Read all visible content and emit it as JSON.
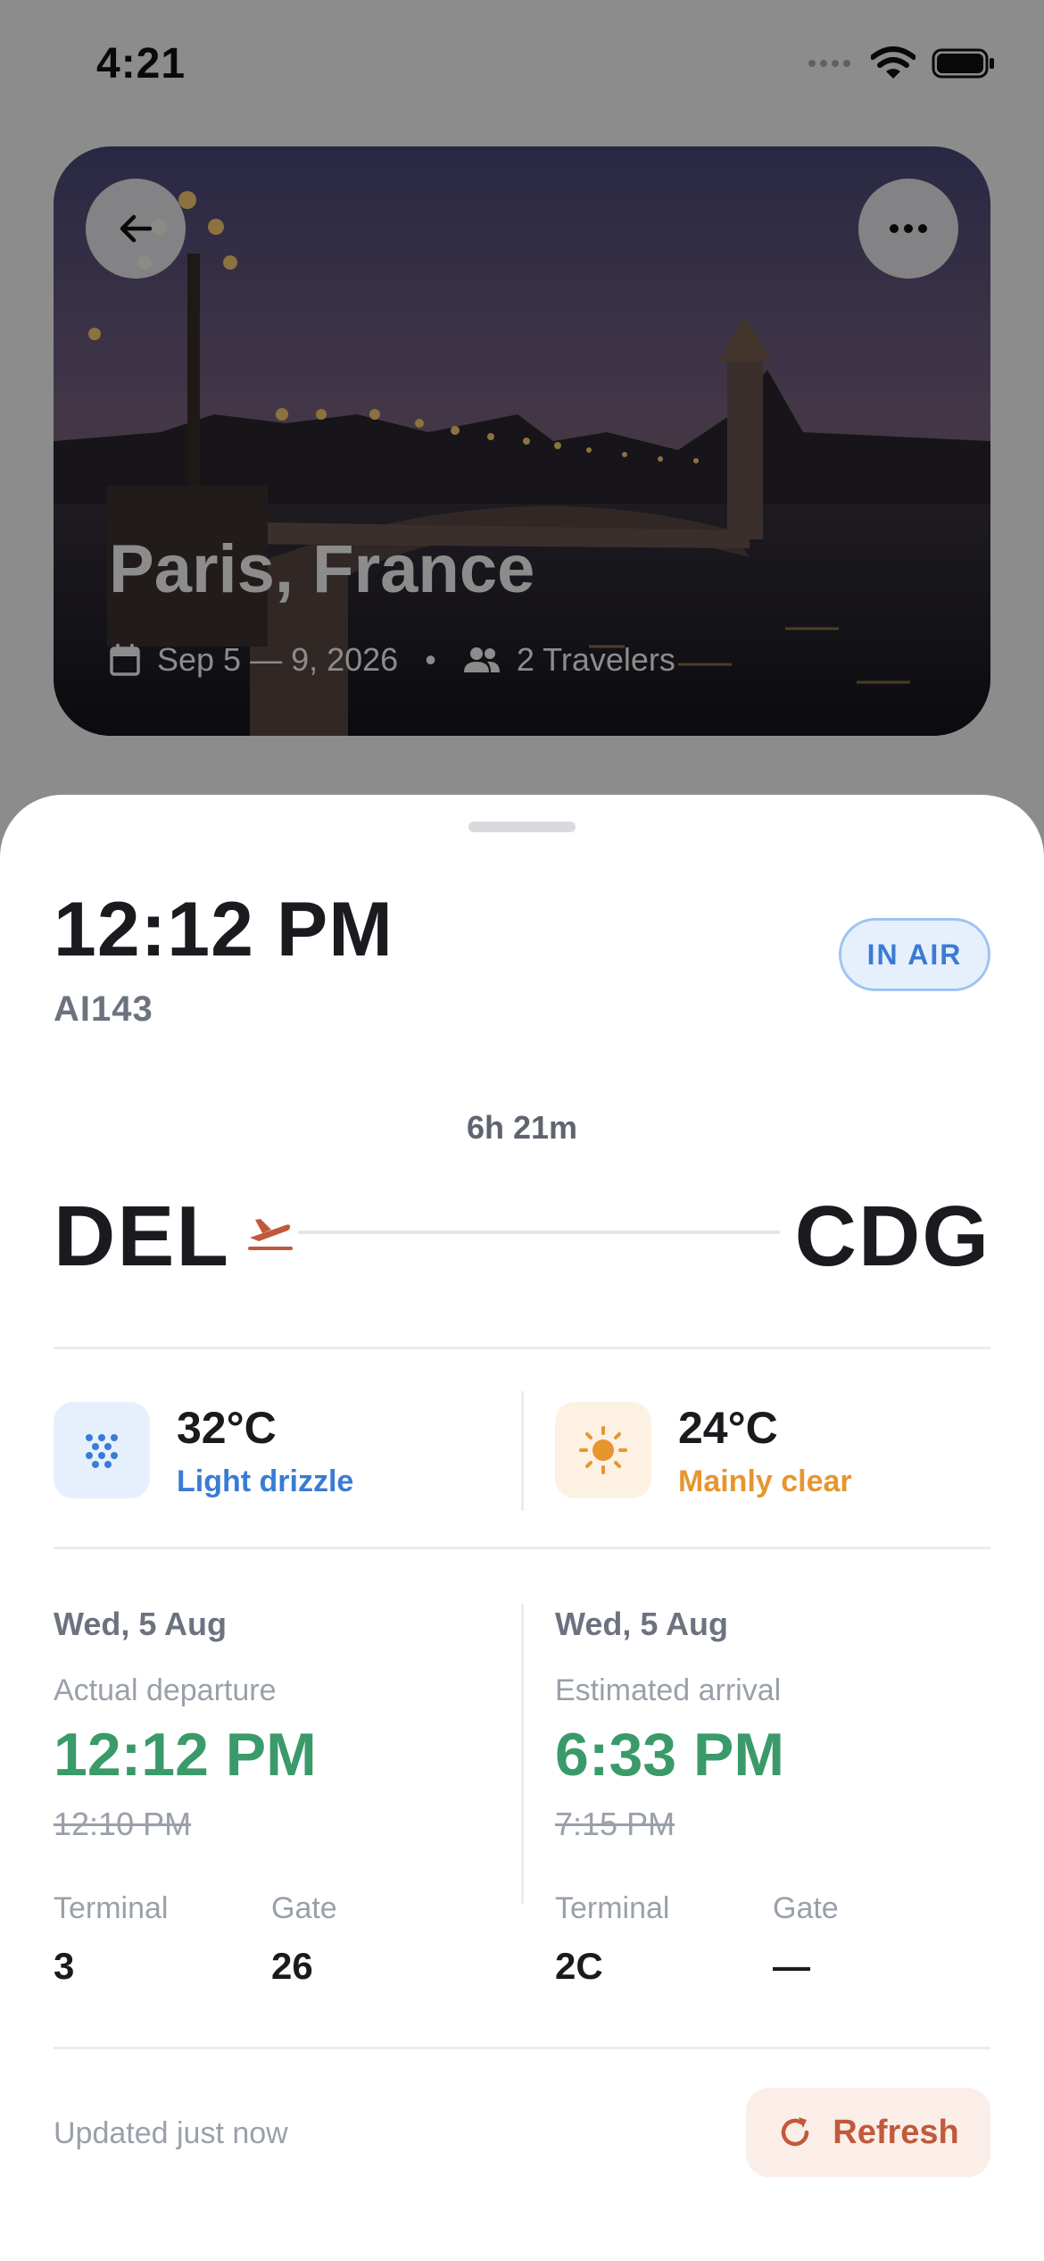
{
  "status_bar": {
    "time": "4:21"
  },
  "hero": {
    "title": "Paris, France",
    "dates": "Sep 5 — 9, 2026",
    "separator": "•",
    "travelers": "2 Travelers"
  },
  "flight": {
    "departure_time": "12:12 PM",
    "number": "AI143",
    "status": "IN AIR",
    "duration": "6h 21m",
    "origin": "DEL",
    "destination": "CDG"
  },
  "weather": {
    "origin": {
      "temp": "32°C",
      "condition": "Light drizzle",
      "icon": "drizzle-icon",
      "color": "#3a7bd5",
      "bg": "#e6f0fc"
    },
    "destination": {
      "temp": "24°C",
      "condition": "Mainly clear",
      "icon": "sun-icon",
      "color": "#e6962f",
      "bg": "#fdf1e3"
    }
  },
  "departure": {
    "date": "Wed, 5 Aug",
    "kind": "Actual departure",
    "time": "12:12 PM",
    "scheduled": "12:10 PM",
    "terminal_label": "Terminal",
    "terminal": "3",
    "gate_label": "Gate",
    "gate": "26"
  },
  "arrival": {
    "date": "Wed, 5 Aug",
    "kind": "Estimated arrival",
    "time": "6:33 PM",
    "scheduled": "7:15 PM",
    "terminal_label": "Terminal",
    "terminal": "2C",
    "gate_label": "Gate",
    "gate": "—"
  },
  "footer": {
    "updated": "Updated just now",
    "refresh_label": "Refresh"
  },
  "colors": {
    "accent_green": "#3a9a6a",
    "accent_blue": "#3a7bd5",
    "accent_orange": "#c05a3b"
  }
}
